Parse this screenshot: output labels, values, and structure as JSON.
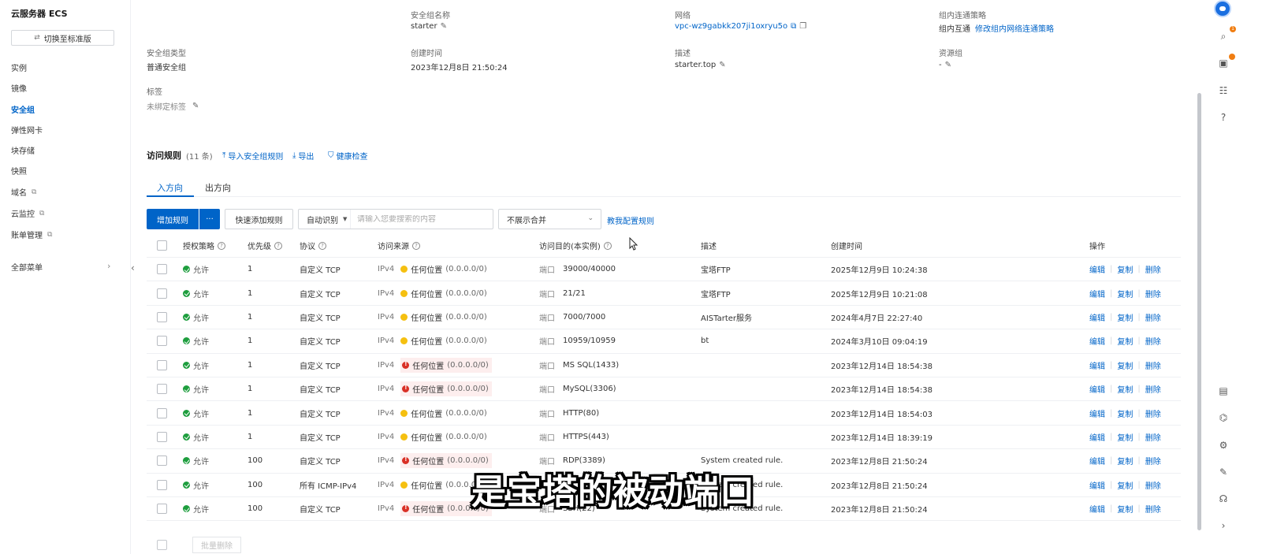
{
  "app": {
    "title": "云服务器 ECS"
  },
  "sidebar": {
    "switch_label": "切换至标准版",
    "items": [
      {
        "label": "实例",
        "active": false,
        "external": false
      },
      {
        "label": "镜像",
        "active": false,
        "external": false
      },
      {
        "label": "安全组",
        "active": true,
        "external": false
      },
      {
        "label": "弹性网卡",
        "active": false,
        "external": false
      },
      {
        "label": "块存储",
        "active": false,
        "external": false
      },
      {
        "label": "快照",
        "active": false,
        "external": false
      },
      {
        "label": "域名",
        "active": false,
        "external": true
      },
      {
        "label": "云监控",
        "active": false,
        "external": true
      },
      {
        "label": "账单管理",
        "active": false,
        "external": true
      }
    ],
    "all_menu_label": "全部菜单"
  },
  "info": {
    "sg_name_label": "安全组名称",
    "sg_name_value": "starter",
    "network_label": "网络",
    "network_value": "vpc-wz9gabkk207ji1oxryu5o",
    "intra_policy_label": "组内连通策略",
    "intra_policy_value": "组内互通",
    "intra_policy_link": "修改组内网络连通策略",
    "sg_type_label": "安全组类型",
    "sg_type_value": "普通安全组",
    "created_label": "创建时间",
    "created_value": "2023年12月8日 21:50:24",
    "desc_label": "描述",
    "desc_value": "starter.top",
    "rg_label": "资源组",
    "rg_value": "-",
    "tag_label": "标签",
    "tag_value": "未绑定标签"
  },
  "rules": {
    "title": "访问规则",
    "count": "(11 条)",
    "import_label": "导入安全组规则",
    "export_label": "导出",
    "health_label": "健康检查",
    "tabs": [
      "入方向",
      "出方向"
    ],
    "add_rule_label": "增加规则",
    "more_label": "···",
    "quick_add_label": "快速添加规则",
    "search_type": "自动识别",
    "search_placeholder": "请输入您要搜索的内容",
    "merge_label": "不展示合并",
    "teach_link": "教我配置规则",
    "bulk_delete_label": "批量删除"
  },
  "table": {
    "headers": {
      "policy": "授权策略",
      "priority": "优先级",
      "protocol": "协议",
      "source": "访问来源",
      "dest": "访问目的(本实例)",
      "desc": "描述",
      "created": "创建时间",
      "ops": "操作"
    },
    "op_labels": {
      "edit": "编辑",
      "copy": "复制",
      "delete": "删除"
    },
    "rows": [
      {
        "policy": "允许",
        "priority": "1",
        "protocol": "自定义 TCP",
        "ip": "IPv4",
        "risk": "yellow",
        "src_name": "任何位置",
        "src_cidr": "(0.0.0.0/0)",
        "port_label": "端口",
        "port": "39000/40000",
        "desc": "宝塔FTP",
        "created": "2025年12月9日 10:24:38"
      },
      {
        "policy": "允许",
        "priority": "1",
        "protocol": "自定义 TCP",
        "ip": "IPv4",
        "risk": "yellow",
        "src_name": "任何位置",
        "src_cidr": "(0.0.0.0/0)",
        "port_label": "端口",
        "port": "21/21",
        "desc": "宝塔FTP",
        "created": "2025年12月9日 10:21:08"
      },
      {
        "policy": "允许",
        "priority": "1",
        "protocol": "自定义 TCP",
        "ip": "IPv4",
        "risk": "yellow",
        "src_name": "任何位置",
        "src_cidr": "(0.0.0.0/0)",
        "port_label": "端口",
        "port": "7000/7000",
        "desc": "AISTarter服务",
        "created": "2024年4月7日 22:27:40"
      },
      {
        "policy": "允许",
        "priority": "1",
        "protocol": "自定义 TCP",
        "ip": "IPv4",
        "risk": "yellow",
        "src_name": "任何位置",
        "src_cidr": "(0.0.0.0/0)",
        "port_label": "端口",
        "port": "10959/10959",
        "desc": "bt",
        "created": "2024年3月10日 09:04:19"
      },
      {
        "policy": "允许",
        "priority": "1",
        "protocol": "自定义 TCP",
        "ip": "IPv4",
        "risk": "red",
        "src_name": "任何位置",
        "src_cidr": "(0.0.0.0/0)",
        "port_label": "端口",
        "port": "MS SQL(1433)",
        "desc": "",
        "created": "2023年12月14日 18:54:38"
      },
      {
        "policy": "允许",
        "priority": "1",
        "protocol": "自定义 TCP",
        "ip": "IPv4",
        "risk": "red",
        "src_name": "任何位置",
        "src_cidr": "(0.0.0.0/0)",
        "port_label": "端口",
        "port": "MySQL(3306)",
        "desc": "",
        "created": "2023年12月14日 18:54:38"
      },
      {
        "policy": "允许",
        "priority": "1",
        "protocol": "自定义 TCP",
        "ip": "IPv4",
        "risk": "yellow",
        "src_name": "任何位置",
        "src_cidr": "(0.0.0.0/0)",
        "port_label": "端口",
        "port": "HTTP(80)",
        "desc": "",
        "created": "2023年12月14日 18:54:03"
      },
      {
        "policy": "允许",
        "priority": "1",
        "protocol": "自定义 TCP",
        "ip": "IPv4",
        "risk": "yellow",
        "src_name": "任何位置",
        "src_cidr": "(0.0.0.0/0)",
        "port_label": "端口",
        "port": "HTTPS(443)",
        "desc": "",
        "created": "2023年12月14日 18:39:19"
      },
      {
        "policy": "允许",
        "priority": "100",
        "protocol": "自定义 TCP",
        "ip": "IPv4",
        "risk": "red",
        "src_name": "任何位置",
        "src_cidr": "(0.0.0.0/0)",
        "port_label": "端口",
        "port": "RDP(3389)",
        "desc": "System created rule.",
        "created": "2023年12月8日 21:50:24"
      },
      {
        "policy": "允许",
        "priority": "100",
        "protocol": "所有 ICMP-IPv4",
        "ip": "IPv4",
        "risk": "yellow",
        "src_name": "任何位置",
        "src_cidr": "(0.0.0.0/0)",
        "port_label": "",
        "port": "",
        "desc": "System created rule.",
        "created": "2023年12月8日 21:50:24"
      },
      {
        "policy": "允许",
        "priority": "100",
        "protocol": "自定义 TCP",
        "ip": "IPv4",
        "risk": "red",
        "src_name": "任何位置",
        "src_cidr": "(0.0.0.0/0)",
        "port_label": "端口",
        "port": "SSH(22)",
        "desc": "System created rule.",
        "created": "2023年12月8日 21:50:24"
      }
    ]
  },
  "subtitle": "是宝塔的被动端口",
  "colors": {
    "accent": "#0064c8",
    "allow": "#1e9e3e",
    "risk_high": "#d93026",
    "risk_low": "#f5c010"
  },
  "icons": [
    "search-icon",
    "gift-icon",
    "list-icon",
    "help-icon",
    "external-link-icon",
    "edit-icon",
    "copy-icon",
    "import-icon",
    "export-icon",
    "shield-check-icon"
  ]
}
